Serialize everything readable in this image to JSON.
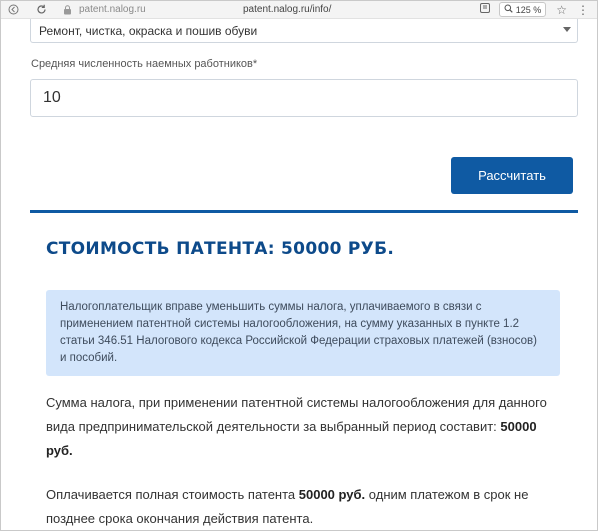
{
  "browser": {
    "host": "patent.nalog.ru",
    "url": "patent.nalog.ru/info/",
    "zoom": "125 %"
  },
  "form": {
    "activity_select": {
      "value": "Ремонт, чистка, окраска и пошив обуви"
    },
    "employees_label": "Средняя численность наемных работников*",
    "employees_value": "10",
    "calculate_button": "Рассчитать"
  },
  "result": {
    "title": "СТОИМОСТЬ ПАТЕНТА: 50000 РУБ.",
    "notice": "Налогоплательщик вправе уменьшить суммы налога, уплачиваемого в связи с применением патентной системы налогообложения, на сумму указанных в пункте 1.2 статьи 346.51 Налогового кодекса Российской Федерации страховых платежей (взносов) и пособий.",
    "para1_text": "Сумма налога, при применении патентной системы налогообложения для данного вида предпринимательской деятельности за выбранный период составит: ",
    "para1_amount": "50000 руб.",
    "para2_text_before": "Оплачивается полная стоимость патента ",
    "para2_amount": "50000 руб.",
    "para2_text_after": " одним платежом в срок не позднее срока окончания действия патента."
  },
  "colors": {
    "accent": "#0f5aa3",
    "title": "#0d4a8a",
    "notice_bg": "#d3e5fb"
  },
  "icons": [
    "back-icon",
    "reload-icon",
    "lock-icon",
    "bookmark-icon",
    "zoom-icon",
    "star-icon",
    "menu-icon"
  ]
}
